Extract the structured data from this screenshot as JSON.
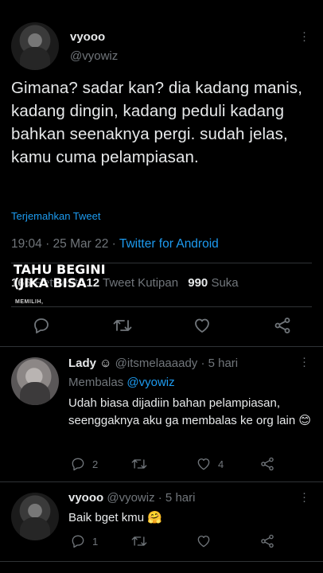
{
  "main_tweet": {
    "display_name": "vyooo",
    "handle": "@vyowiz",
    "text": "Gimana? sadar kan? dia kadang manis, kadang dingin, kadang peduli kadang bahkan seenaknya pergi. sudah jelas, kamu cuma pelampiasan.",
    "translate_label": "Terjemahkan Tweet",
    "timestamp": "19:04 · 25 Mar 22 · ",
    "source": "Twitter for Android",
    "stats": {
      "retweets_count": "166",
      "retweets_label": "Retweet",
      "quotes_count": "12",
      "quotes_label": "Tweet Kutipan",
      "likes_count": "990",
      "likes_label": "Suka"
    },
    "watermark": {
      "line1": "TAHU BEGINI",
      "line2": "(JIKA BISA",
      "line3": "MEMILIH,"
    }
  },
  "replies": [
    {
      "display_name": "Lady ☺",
      "handle": "@itsmelaaaady",
      "time": "· 5 hari",
      "replying_prefix": "Membalas",
      "replying_to": "@vyowiz",
      "text": "Udah biasa dijadiin bahan pelampiasan, seenggaknya aku ga membalas ke org lain 😊",
      "reply_count": "2",
      "like_count": "4"
    },
    {
      "display_name": "vyooo",
      "handle": "@vyowiz",
      "time": "· 5 hari",
      "text": "Baik bget kmu 🤗",
      "reply_count": "1"
    }
  ],
  "icons": [
    "reply-icon",
    "retweet-icon",
    "like-icon",
    "share-icon",
    "more-options-icon"
  ],
  "colors": {
    "background": "#000000",
    "text": "#e7e9ea",
    "muted": "#71767b",
    "link": "#1d9bf0"
  }
}
